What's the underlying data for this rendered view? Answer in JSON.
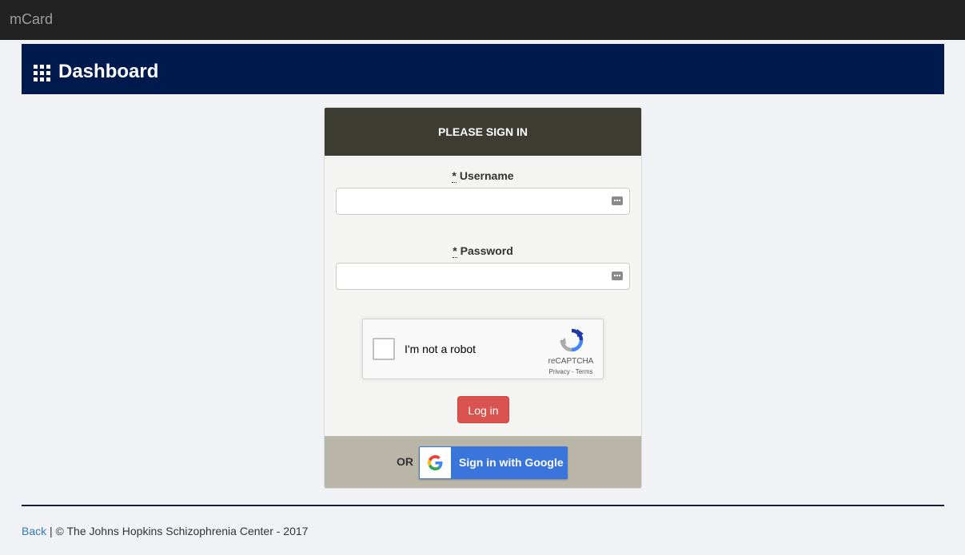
{
  "navbar": {
    "brand": "mCard"
  },
  "banner": {
    "icon": "grid-icon",
    "title": "Dashboard"
  },
  "signin": {
    "heading": "PLEASE SIGN IN",
    "required_marker": "*",
    "username": {
      "label": "Username",
      "value": "",
      "icon": "key-icon"
    },
    "password": {
      "label": "Password",
      "value": "",
      "icon": "key-icon"
    },
    "recaptcha": {
      "label": "I'm not a robot",
      "brand": "reCAPTCHA",
      "links": "Privacy - Terms",
      "checked": false
    },
    "login_label": "Log in",
    "or_label": "OR",
    "google_label": "Sign in with Google"
  },
  "footer": {
    "back_label": "Back",
    "separator": "|",
    "copyright": "© The Johns Hopkins Schizophrenia Center - 2017"
  },
  "colors": {
    "navbar": "#222222",
    "banner": "#001a4d",
    "panel_heading": "#3d3c33",
    "panel_footer": "#b9b6a8",
    "login_button": "#d9534f",
    "google_button": "#3a75dc",
    "link": "#337ab7"
  }
}
